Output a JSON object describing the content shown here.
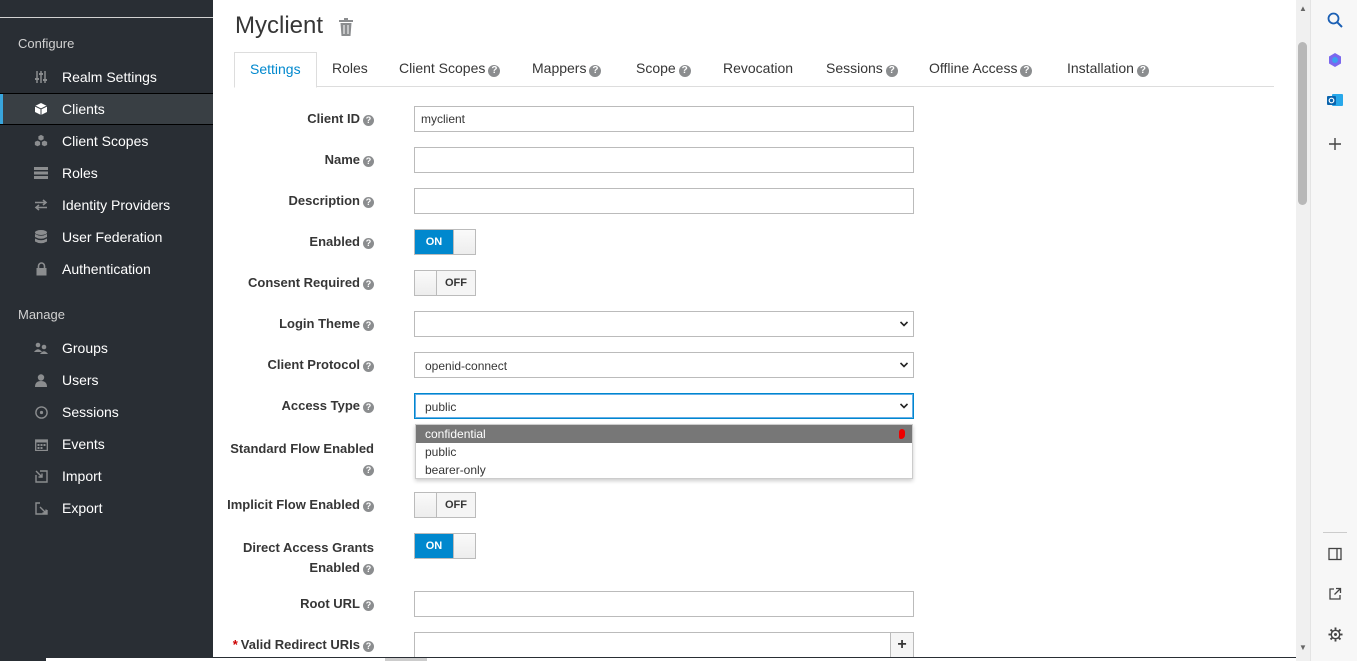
{
  "sidebar": {
    "configure_title": "Configure",
    "manage_title": "Manage",
    "configure_items": [
      {
        "label": "Realm Settings",
        "icon": "sliders-icon"
      },
      {
        "label": "Clients",
        "icon": "cube-icon",
        "active": true
      },
      {
        "label": "Client Scopes",
        "icon": "cubes-icon"
      },
      {
        "label": "Roles",
        "icon": "list-icon"
      },
      {
        "label": "Identity Providers",
        "icon": "exchange-icon"
      },
      {
        "label": "User Federation",
        "icon": "database-icon"
      },
      {
        "label": "Authentication",
        "icon": "lock-icon"
      }
    ],
    "manage_items": [
      {
        "label": "Groups",
        "icon": "users-icon"
      },
      {
        "label": "Users",
        "icon": "user-icon"
      },
      {
        "label": "Sessions",
        "icon": "clock-icon"
      },
      {
        "label": "Events",
        "icon": "calendar-icon"
      },
      {
        "label": "Import",
        "icon": "import-icon"
      },
      {
        "label": "Export",
        "icon": "export-icon"
      }
    ]
  },
  "header": {
    "title": "Myclient"
  },
  "tabs": [
    {
      "label": "Settings",
      "help": false,
      "active": true
    },
    {
      "label": "Roles",
      "help": false
    },
    {
      "label": "Client Scopes",
      "help": true
    },
    {
      "label": "Mappers",
      "help": true
    },
    {
      "label": "Scope",
      "help": true
    },
    {
      "label": "Revocation",
      "help": false
    },
    {
      "label": "Sessions",
      "help": true
    },
    {
      "label": "Offline Access",
      "help": true
    },
    {
      "label": "Installation",
      "help": true
    }
  ],
  "form": {
    "client_id": {
      "label": "Client ID",
      "value": "myclient"
    },
    "name": {
      "label": "Name",
      "value": ""
    },
    "description": {
      "label": "Description",
      "value": ""
    },
    "enabled": {
      "label": "Enabled",
      "state": "ON"
    },
    "consent_required": {
      "label": "Consent Required",
      "state": "OFF"
    },
    "login_theme": {
      "label": "Login Theme",
      "value": ""
    },
    "client_protocol": {
      "label": "Client Protocol",
      "value": "openid-connect"
    },
    "access_type": {
      "label": "Access Type",
      "value": "public",
      "options": [
        "confidential",
        "public",
        "bearer-only"
      ]
    },
    "standard_flow": {
      "label": "Standard Flow Enabled"
    },
    "implicit_flow": {
      "label": "Implicit Flow Enabled",
      "state": "OFF"
    },
    "direct_access": {
      "label_line1": "Direct Access Grants",
      "label_line2": "Enabled",
      "state": "ON"
    },
    "root_url": {
      "label": "Root URL",
      "value": ""
    },
    "redirect_uris": {
      "label": "Valid Redirect URIs",
      "required_mark": "*",
      "value": "",
      "add": "+"
    }
  },
  "colors": {
    "sidebar_bg": "#292e34",
    "accent": "#0088ce"
  }
}
